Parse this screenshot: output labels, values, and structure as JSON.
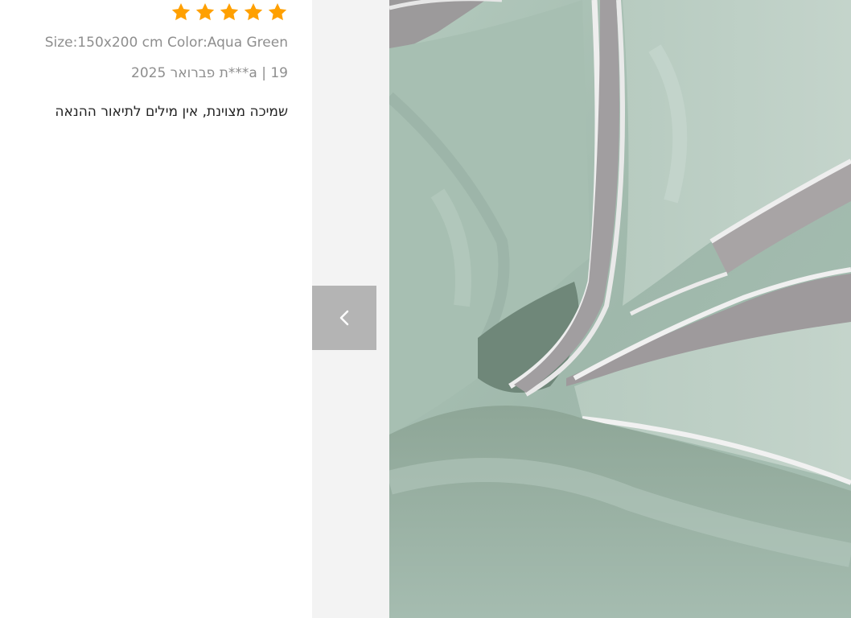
{
  "review": {
    "rating": 5,
    "rating_max": 5,
    "variant": "Size:150x200 cm Color:Aqua Green",
    "meta": "19 | a***ת פברואר 2025",
    "text": "שמיכה מצוינת, אין מילים לתיאור ההנאה"
  },
  "gallery": {
    "prev_icon": "chevron-left-icon",
    "photo_subject": "aqua green duvet with white piping"
  },
  "colors": {
    "star": "#ffa000",
    "muted_text": "#8e8e8e",
    "body_text": "#222222",
    "gallery_bg": "#f3f3f3",
    "nav_button": "#b4b4b4"
  }
}
